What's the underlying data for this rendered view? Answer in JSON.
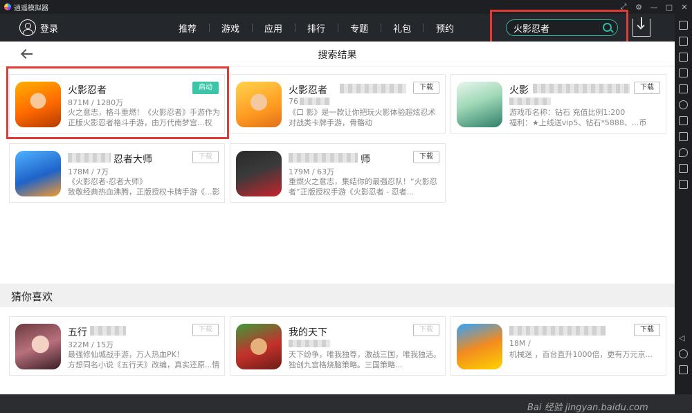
{
  "window": {
    "title": "逍遥模拟器"
  },
  "header": {
    "login_label": "登录",
    "nav_items": [
      "推荐",
      "游戏",
      "应用",
      "排行",
      "专题",
      "礼包",
      "预约"
    ],
    "search_value": "火影忍者"
  },
  "page_title": "搜索结果",
  "results": [
    {
      "name": "火影忍者",
      "meta": "871M / 1280万",
      "desc": "火之意志，格斗重燃！《火影忍者》手游作为正版火影忍者格斗手游，由万代南梦宫...权",
      "button": "启动"
    },
    {
      "name": "火影忍者",
      "meta": "76",
      "desc": "《口 影》是一款让你把玩火影体验超炫忍术 对战类卡牌手游，骨骼动",
      "button": "下载"
    },
    {
      "name": "火影",
      "meta": "",
      "desc": "游戏币名称：钻石 充值比例1:200\n福利：★上线送vip5、钻石*5888、...币*50W",
      "button": "下载"
    },
    {
      "name": "忍者大师",
      "meta": "178M / 7万",
      "desc": "《火影忍者-忍者大师》\n致敬经典热血沸腾，正版授权卡牌手游《...影",
      "button": "下载"
    },
    {
      "name": "师",
      "meta": "179M / 63万",
      "desc": "重燃火之意志，集结你的最强忍队！“火影忍者”正版授权手游《火影忍者 - 忍者...",
      "button": "下载"
    }
  ],
  "section_title": "猜你喜欢",
  "recommendations": [
    {
      "name": "五行",
      "meta": "322M / 15万",
      "desc": "最强修仙城战手游，万人热血PK！\n方想同名小说《五行天》改编，真实还原...情",
      "button": "下载"
    },
    {
      "name": "我的天下",
      "meta": "",
      "desc": "天下纷争，唯我独尊，激战三国，唯我独活。独创九宫格烧脑策略。三国策略...",
      "button": "下载"
    },
    {
      "name": "",
      "meta": "18M /",
      "desc": "机械迷 ，百台直升1000倍，更有万元京...",
      "button": "下载"
    }
  ],
  "watermark": "Bai 经验 jingyan.baidu.com"
}
